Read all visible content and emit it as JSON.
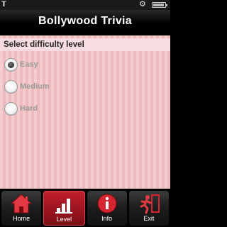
{
  "app": {
    "title": "Bollywood Trivia"
  },
  "status_bar": {
    "signal_icon": "signal-icon",
    "settings_icon": "gear-icon",
    "battery_icon": "battery-icon"
  },
  "difficulty": {
    "heading": "Select difficulty level",
    "options": [
      {
        "label": "Easy",
        "selected": true
      },
      {
        "label": "Medium",
        "selected": false
      },
      {
        "label": "Hard",
        "selected": false
      }
    ]
  },
  "tabs": [
    {
      "label": "Home",
      "icon": "home-icon",
      "active": false
    },
    {
      "label": "Level",
      "icon": "level-bars-icon",
      "active": true
    },
    {
      "label": "Info",
      "icon": "info-icon",
      "active": false
    },
    {
      "label": "Exit",
      "icon": "exit-runner-icon",
      "active": false
    }
  ],
  "colors": {
    "accent": "#c0202c",
    "background": "#f1c3c6",
    "title_bar": "#000000"
  }
}
